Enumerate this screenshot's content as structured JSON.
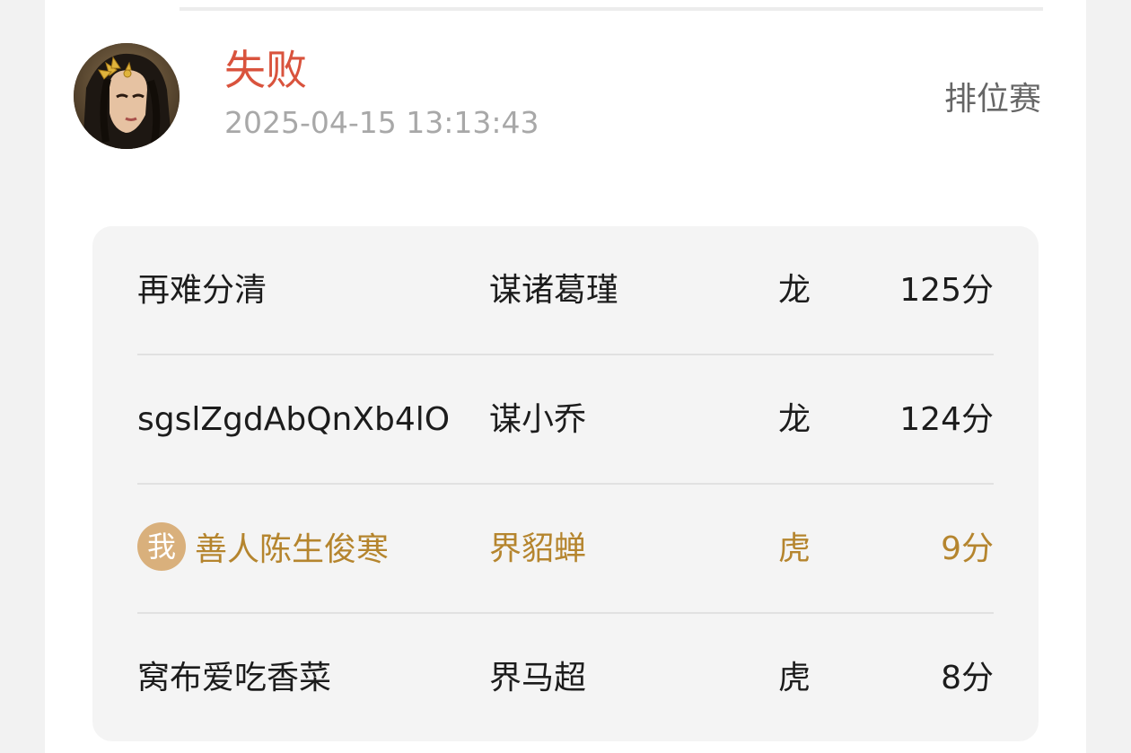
{
  "match": {
    "result": "失败",
    "timestamp": "2025-04-15 13:13:43",
    "mode": "排位赛"
  },
  "colors": {
    "result_loss": "#d9533d",
    "me_highlight": "#b5852e",
    "me_badge_bg": "#d9b07c"
  },
  "players": [
    {
      "name": "再难分清",
      "hero": "谋诸葛瑾",
      "team": "龙",
      "score": "125分",
      "is_me": false
    },
    {
      "name": "sgslZgdAbQnXb4lO",
      "hero": "谋小乔",
      "team": "龙",
      "score": "124分",
      "is_me": false
    },
    {
      "name": "善人陈生俊寒",
      "hero": "界貂蝉",
      "team": "虎",
      "score": "9分",
      "is_me": true,
      "badge": "我"
    },
    {
      "name": "窝布爱吃香菜",
      "hero": "界马超",
      "team": "虎",
      "score": "8分",
      "is_me": false
    }
  ]
}
